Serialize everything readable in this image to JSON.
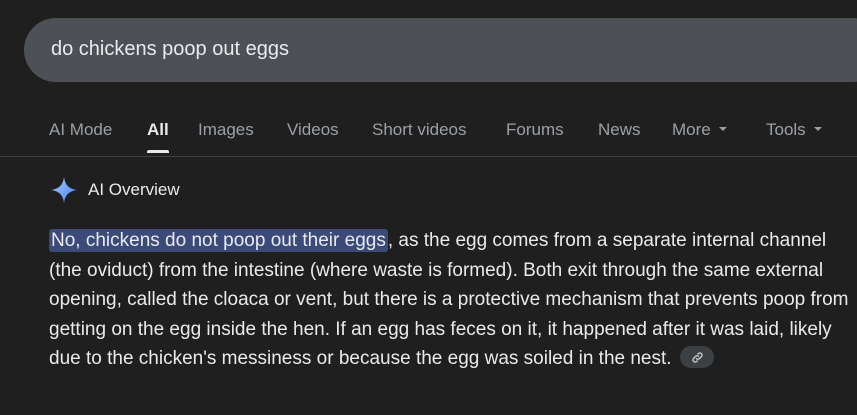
{
  "search": {
    "query": "do chickens poop out eggs"
  },
  "tabs": [
    {
      "label": "AI Mode"
    },
    {
      "label": "All",
      "active": true
    },
    {
      "label": "Images"
    },
    {
      "label": "Videos"
    },
    {
      "label": "Short videos"
    },
    {
      "label": "Forums"
    },
    {
      "label": "News"
    },
    {
      "label": "More"
    },
    {
      "label": "Tools"
    }
  ],
  "ai_overview": {
    "title": "AI Overview",
    "highlight": "No, chickens do not poop out their eggs",
    "body": ", as the egg comes from a separate internal channel (the oviduct) from the intestine (where waste is formed). Both exit through the same external opening, called the cloaca or vent, but there is a protective mechanism that prevents poop from getting on the egg inside the hen. If an egg has feces on it, it happened after it was laid, likely due to the chicken's messiness or because the egg was soiled in the nest.",
    "link_icon": "link-icon"
  },
  "colors": {
    "background": "#1f1f1f",
    "search_bar": "#4d5156",
    "highlight": "#3c4a7a",
    "sparkle": "#8ab4f8"
  }
}
